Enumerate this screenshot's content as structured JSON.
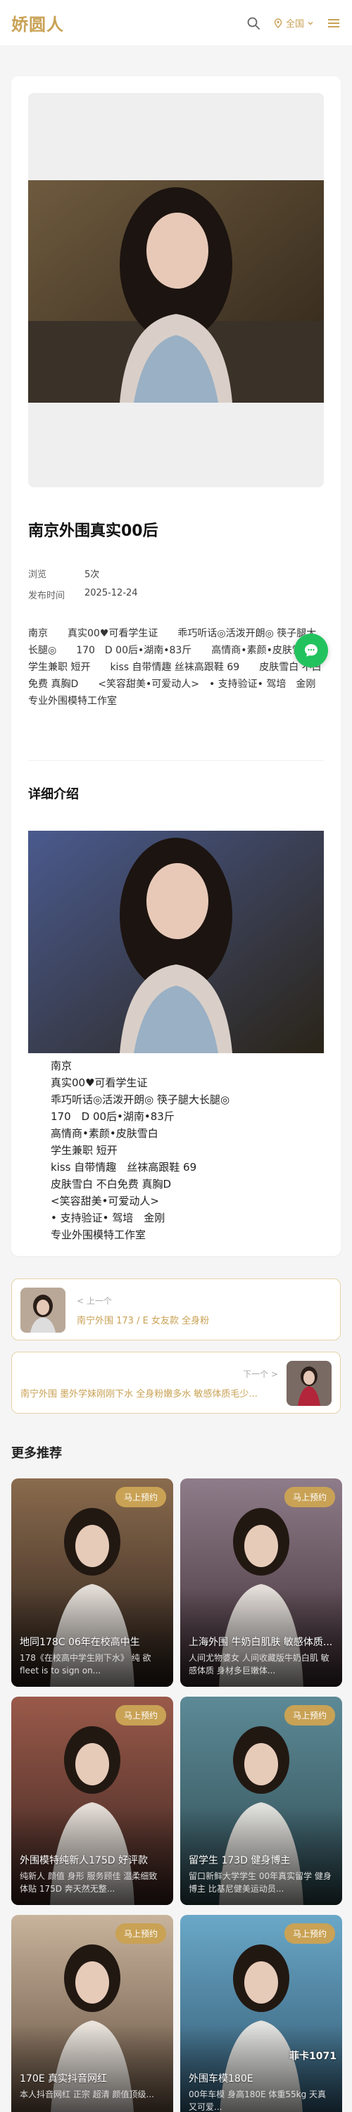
{
  "header": {
    "logo": "娇圆人",
    "region_label": "全国"
  },
  "post": {
    "title": "南京外围真实00后",
    "views_label": "浏览",
    "views": "5次",
    "date_label": "发布时间",
    "date": "2025-12-24",
    "tagline": "南京　　真实00♥可看学生证　　乖巧听话◎活泼开朗◎ 筷子腿大长腿◎　　170　D 00后•湖南•83斤　　高情商•素颜•皮肤雪白　　学生兼职 短开　　kiss 自带情趣 丝袜高跟鞋 69　　皮肤雪白 不白免费 真胸D　　<笑容甜美•可爱动人>　• 支持验证• 驾培　金刚　　专业外围模特工作室"
  },
  "detail": {
    "title": "详细介绍",
    "lines": [
      "南京",
      "真实00♥可看学生证",
      "乖巧听话◎活泼开朗◎ 筷子腿大长腿◎",
      "170　D 00后•湖南•83斤",
      "高情商•素颜•皮肤雪白",
      "学生兼职 短开",
      "kiss 自带情趣　丝袜高跟鞋 69",
      "皮肤雪白 不白免费 真胸D",
      "<笑容甜美•可爱动人>",
      "• 支持验证• 驾培　金刚",
      "专业外围模特工作室"
    ]
  },
  "nav": {
    "prev_label": "< 上一个",
    "prev_title": "南宁外围 173 / E 女友款 全身粉",
    "next_label": "下一个 >",
    "next_title": "南宁外围 墨外学妹刚刚下水 全身粉嫩多水 敏感体质毛少..."
  },
  "more": {
    "title": "更多推荐",
    "badge": "马上预约",
    "items": [
      {
        "title": "地同178C 06年在校高中生",
        "desc": "178《在校高中学生刚下水》 纯 欲 fleet is to sign on...",
        "colors": [
          "#8a6b4d",
          "#2a1f1a"
        ]
      },
      {
        "title": "上海外围 牛奶白肌肤 敏感体质...",
        "desc": "人间尤物婆女 人间收藏版牛奶白肌 敏感体质 身材多巨嫩体...",
        "colors": [
          "#8f7c8a",
          "#3b2b30"
        ]
      },
      {
        "title": "外围模特纯新人175D 好评款",
        "desc": "纯新人 颜值 身形 服务顾佳 温柔细致体贴 175D 奔天然无整...",
        "colors": [
          "#9a5a4a",
          "#3a2420"
        ]
      },
      {
        "title": "留学生 173D 健身博主",
        "desc": "留口新鲜大学学生 00年真实留学 健身博主 比基尼健美运动员...",
        "colors": [
          "#5c8a96",
          "#2e4a52"
        ]
      },
      {
        "title": "170E 真实抖音网红",
        "desc": "本人抖音网红 正宗 超清 颜值顶级...",
        "colors": [
          "#c8b49c",
          "#5a4637"
        ]
      },
      {
        "title": "外围车模180E",
        "desc": "00年车模 身高180E 体重55kg 天真又可爱...",
        "colors": [
          "#6aa8c8",
          "#2c5068"
        ]
      }
    ],
    "watermark": "菲卡1071"
  },
  "colors": {
    "accent": "#c9a255",
    "fab": "#22c35e"
  }
}
